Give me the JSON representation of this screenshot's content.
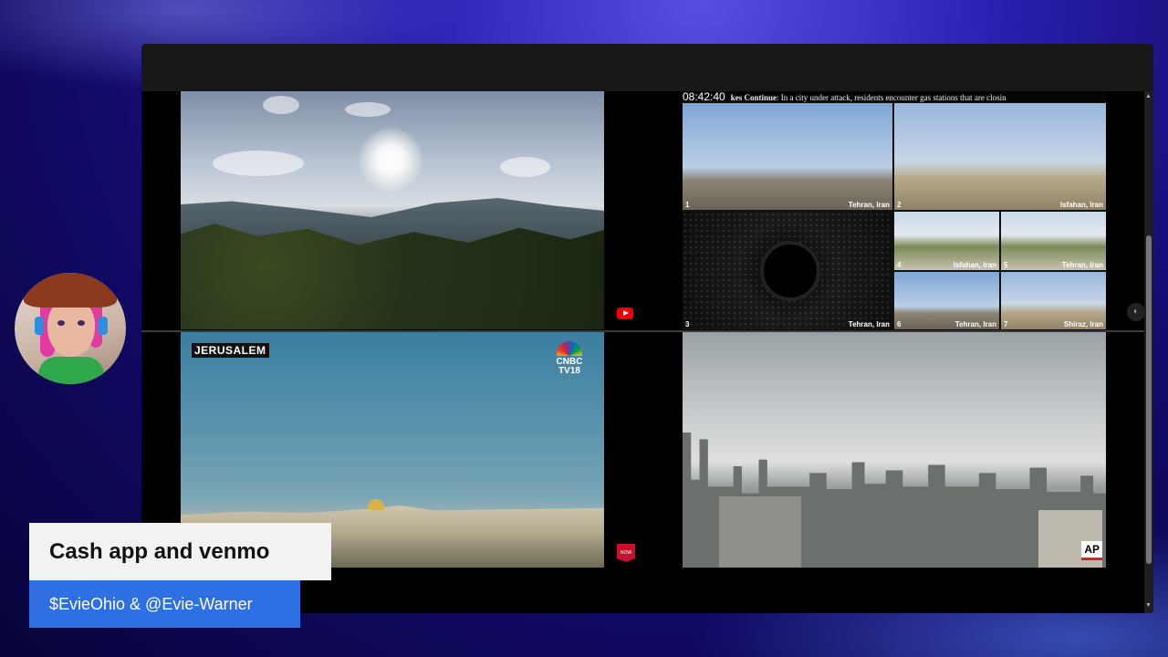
{
  "stream": {
    "ticker": {
      "time": "08:42:40",
      "headline": "kes Continue",
      "text": ": In a city under attack, residents encounter gas stations that are closin"
    },
    "panels": {
      "jerusalem_label": "JERUSALEM",
      "cnbc_logo_line1": "CNBC",
      "cnbc_logo_line2": "TV18",
      "ap_logo": "AP",
      "now_badge": "NOW"
    },
    "cams": [
      {
        "num": "1",
        "label": "Tehran, Iran"
      },
      {
        "num": "2",
        "label": "Isfahan, Iran"
      },
      {
        "num": "3",
        "label": "Tehran, Iran"
      },
      {
        "num": "4",
        "label": "Isfahan, Iran"
      },
      {
        "num": "5",
        "label": "Tehran, Iran"
      },
      {
        "num": "6",
        "label": "Tehran, Iran"
      },
      {
        "num": "7",
        "label": "Shiraz, Iran"
      }
    ],
    "icons": [
      "youtube-icon",
      "cnbc-peacock-icon",
      "ap-logo",
      "scroll-up-icon",
      "scroll-down-icon"
    ]
  },
  "overlay": {
    "title": "Cash app and venmo",
    "subtitle": "$EvieOhio & @Evie-Warner"
  },
  "colors": {
    "subtitle_bg": "#2f6fe4",
    "title_bg": "#f2f2f2",
    "youtube_red": "#ee0000"
  }
}
